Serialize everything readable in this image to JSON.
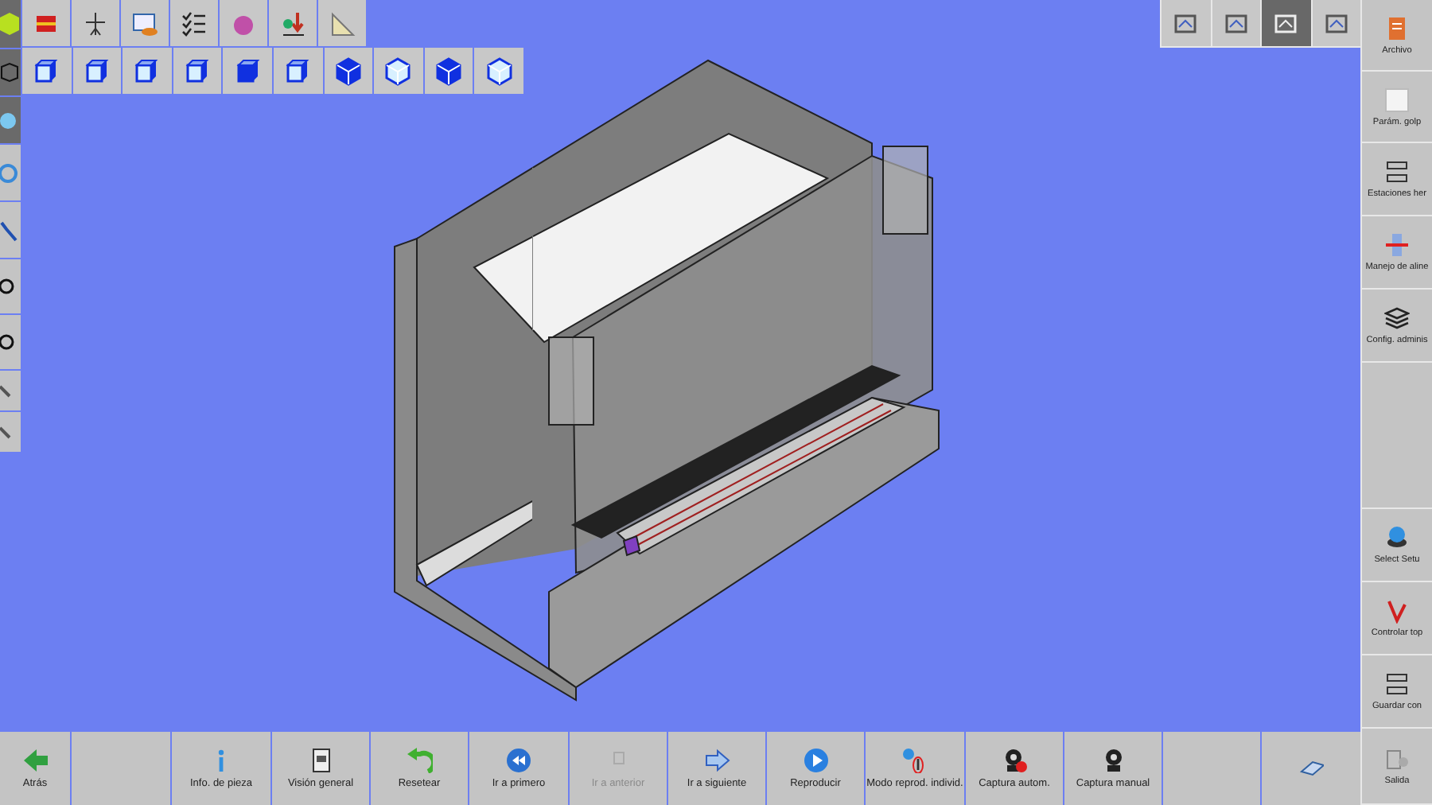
{
  "view_selector": [
    {
      "selected": false
    },
    {
      "selected": false
    },
    {
      "selected": true
    },
    {
      "selected": false
    }
  ],
  "sidebar": [
    {
      "label": "Archivo"
    },
    {
      "label": "Parám. golp"
    },
    {
      "label": "Estaciones her"
    },
    {
      "label": "Manejo de aline"
    },
    {
      "label": "Config. adminis"
    },
    {
      "kind": "blank"
    },
    {
      "label": "Select Setu"
    },
    {
      "label": "Controlar top"
    },
    {
      "label": "Guardar con"
    },
    {
      "label": "Salida"
    }
  ],
  "bottom_bar": [
    {
      "label": "Atrás",
      "disabled": false
    },
    {
      "kind": "blank"
    },
    {
      "label": "Info. de pieza",
      "disabled": false
    },
    {
      "label": "Visión general",
      "disabled": false
    },
    {
      "label": "Resetear",
      "disabled": false
    },
    {
      "label": "Ir a primero",
      "disabled": false
    },
    {
      "label": "Ir a anterior",
      "disabled": true
    },
    {
      "label": "Ir a siguiente",
      "disabled": false
    },
    {
      "label": "Reproducir",
      "disabled": false
    },
    {
      "label": "Modo reprod. individ.",
      "disabled": false
    },
    {
      "label": "Captura autom.",
      "disabled": false
    },
    {
      "label": "Captura manual",
      "disabled": false
    },
    {
      "kind": "blank"
    },
    {
      "kind": "icon"
    }
  ]
}
